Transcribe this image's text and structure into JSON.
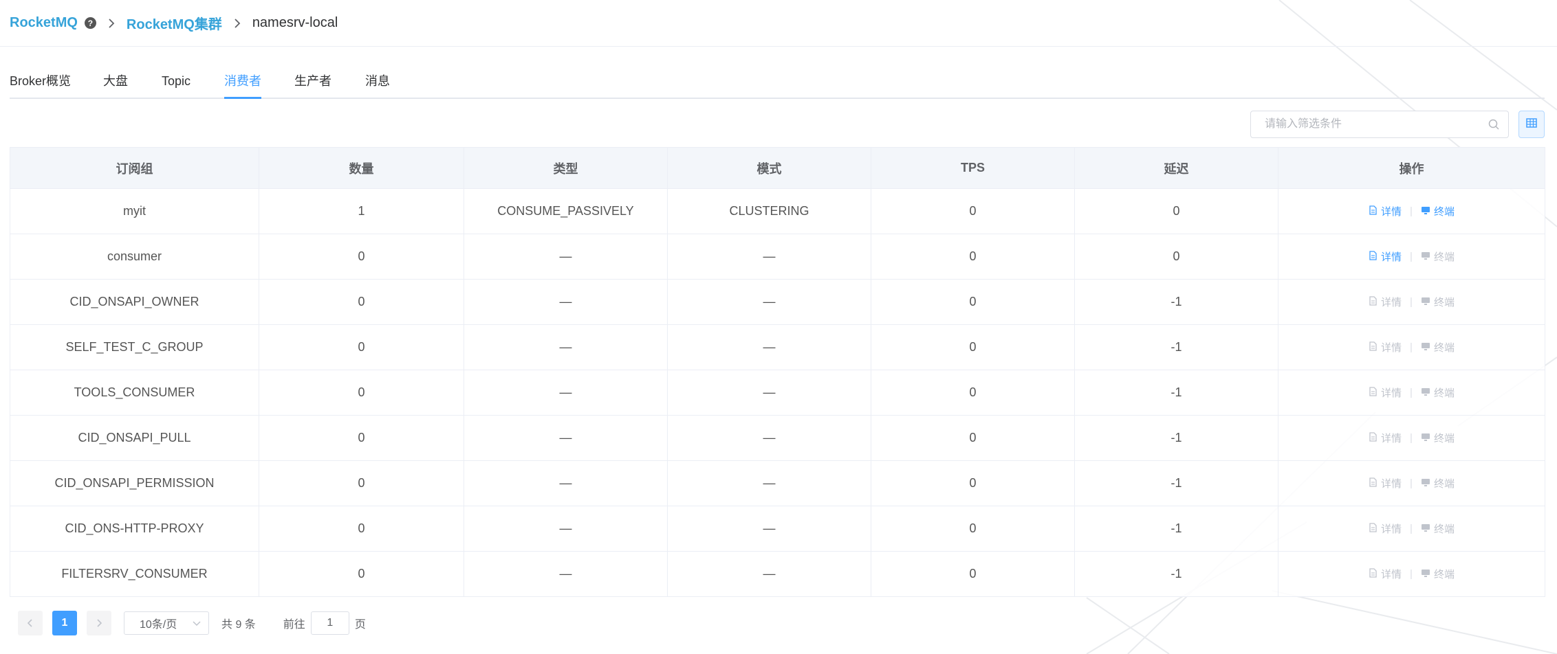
{
  "breadcrumb": {
    "root": "RocketMQ",
    "cluster": "RocketMQ集群",
    "current": "namesrv-local"
  },
  "tabs": [
    {
      "label": "Broker概览",
      "active": false
    },
    {
      "label": "大盘",
      "active": false
    },
    {
      "label": "Topic",
      "active": false
    },
    {
      "label": "消费者",
      "active": true
    },
    {
      "label": "生产者",
      "active": false
    },
    {
      "label": "消息",
      "active": false
    }
  ],
  "toolbar": {
    "search_placeholder": "请输入筛选条件"
  },
  "table": {
    "columns": [
      "订阅组",
      "数量",
      "类型",
      "模式",
      "TPS",
      "延迟",
      "操作"
    ],
    "detail_label": "详情",
    "terminal_label": "终端",
    "rows": [
      {
        "group": "myit",
        "count": "1",
        "type": "CONSUME_PASSIVELY",
        "mode": "CLUSTERING",
        "tps": "0",
        "delay": "0",
        "detail_enabled": true,
        "terminal_enabled": true
      },
      {
        "group": "consumer",
        "count": "0",
        "type": "—",
        "mode": "—",
        "tps": "0",
        "delay": "0",
        "detail_enabled": true,
        "terminal_enabled": false
      },
      {
        "group": "CID_ONSAPI_OWNER",
        "count": "0",
        "type": "—",
        "mode": "—",
        "tps": "0",
        "delay": "-1",
        "detail_enabled": false,
        "terminal_enabled": false
      },
      {
        "group": "SELF_TEST_C_GROUP",
        "count": "0",
        "type": "—",
        "mode": "—",
        "tps": "0",
        "delay": "-1",
        "detail_enabled": false,
        "terminal_enabled": false
      },
      {
        "group": "TOOLS_CONSUMER",
        "count": "0",
        "type": "—",
        "mode": "—",
        "tps": "0",
        "delay": "-1",
        "detail_enabled": false,
        "terminal_enabled": false
      },
      {
        "group": "CID_ONSAPI_PULL",
        "count": "0",
        "type": "—",
        "mode": "—",
        "tps": "0",
        "delay": "-1",
        "detail_enabled": false,
        "terminal_enabled": false
      },
      {
        "group": "CID_ONSAPI_PERMISSION",
        "count": "0",
        "type": "—",
        "mode": "—",
        "tps": "0",
        "delay": "-1",
        "detail_enabled": false,
        "terminal_enabled": false
      },
      {
        "group": "CID_ONS-HTTP-PROXY",
        "count": "0",
        "type": "—",
        "mode": "—",
        "tps": "0",
        "delay": "-1",
        "detail_enabled": false,
        "terminal_enabled": false
      },
      {
        "group": "FILTERSRV_CONSUMER",
        "count": "0",
        "type": "—",
        "mode": "—",
        "tps": "0",
        "delay": "-1",
        "detail_enabled": false,
        "terminal_enabled": false
      }
    ]
  },
  "pagination": {
    "current_page": "1",
    "page_size": "10条/页",
    "total": "共 9 条",
    "goto_prefix": "前往",
    "goto_value": "1",
    "goto_suffix": "页"
  },
  "colors": {
    "accent": "#409eff",
    "brand": "#36a3d9",
    "disabled": "#c0c4cc"
  }
}
